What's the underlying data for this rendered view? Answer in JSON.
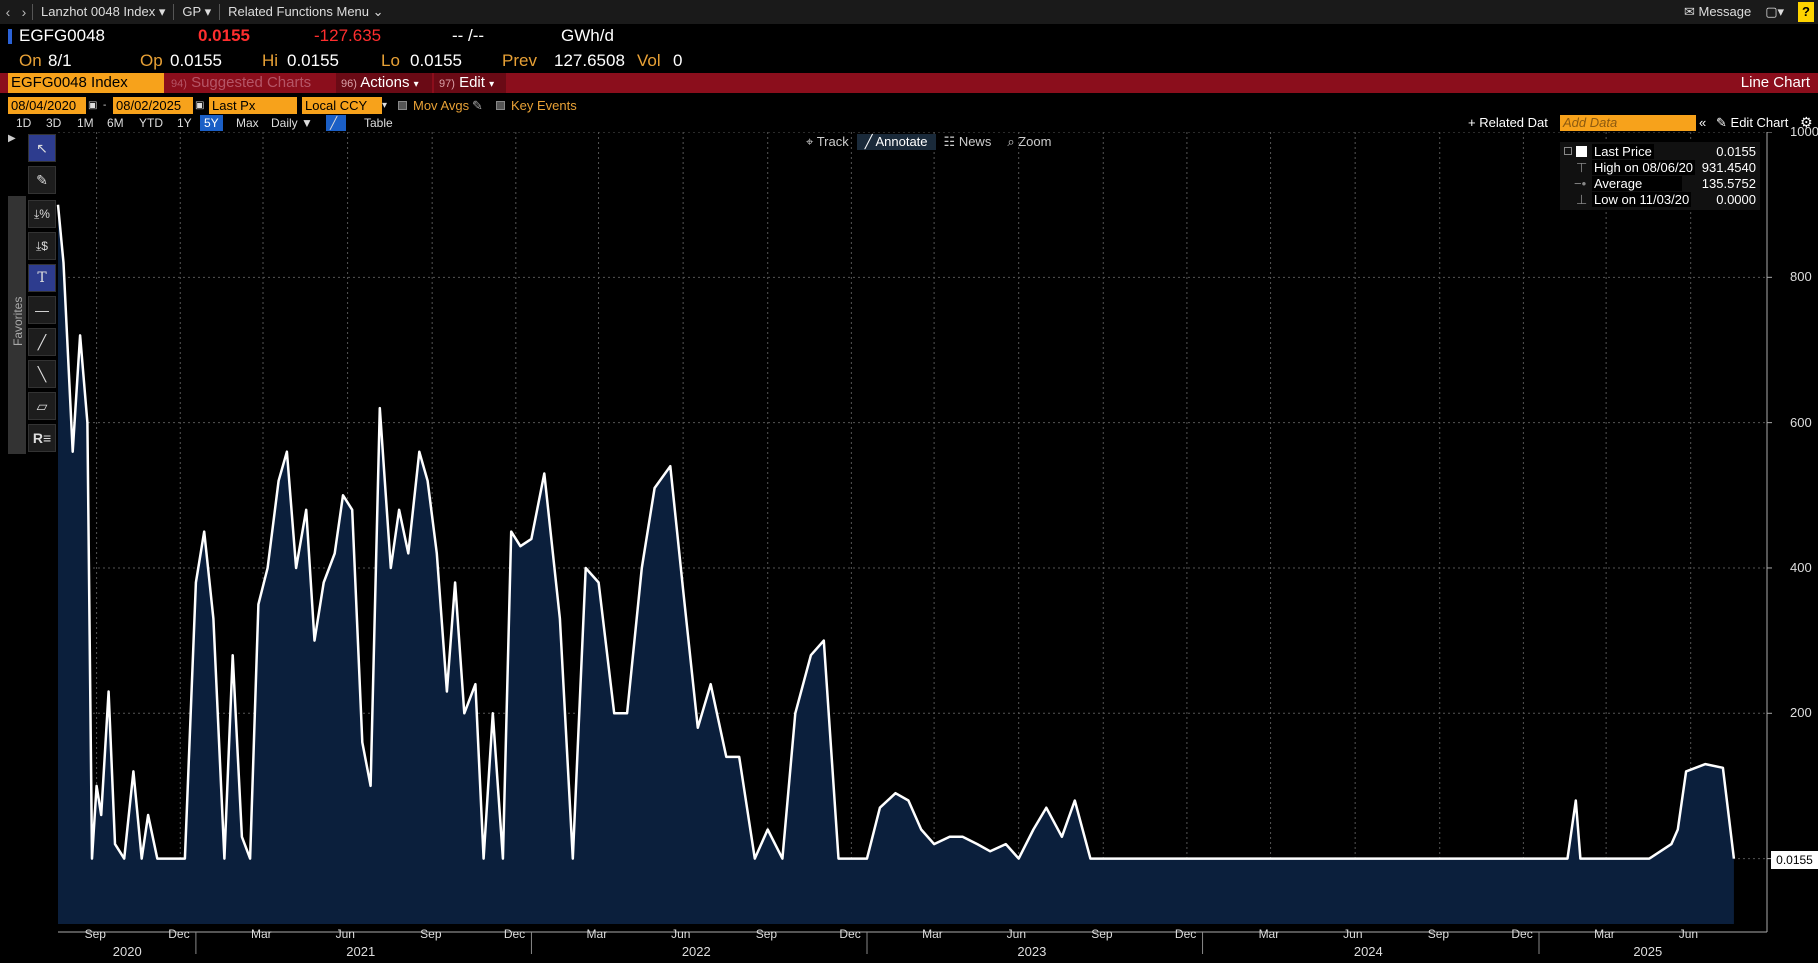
{
  "topbar": {
    "menu1": "Lanzhot 0048 Index",
    "menu2": "GP",
    "menu3": "Related Functions Menu",
    "message": "Message",
    "help": "?"
  },
  "quote": {
    "ticker": "EGFG0048",
    "last": "0.0155",
    "change": "-127.635",
    "time": "-- /--",
    "unit": "GWh/d",
    "on_label": "On",
    "on_date": "8/1",
    "op_label": "Op",
    "op": "0.0155",
    "hi_label": "Hi",
    "hi": "0.0155",
    "lo_label": "Lo",
    "lo": "0.0155",
    "prev_label": "Prev",
    "prev": "127.6508",
    "vol_label": "Vol",
    "vol": "0"
  },
  "redbar": {
    "ticker_field": "EGFG0048 Index",
    "suggested_num": "94)",
    "suggested": "Suggested Charts",
    "actions_num": "96)",
    "actions": "Actions",
    "edit_num": "97)",
    "edit": "Edit",
    "chart_type": "Line Chart"
  },
  "daterow": {
    "start": "08/04/2020",
    "end": "08/02/2025",
    "field": "Last Px",
    "ccy": "Local CCY",
    "mov_avgs": "Mov Avgs",
    "key_events": "Key Events"
  },
  "periods": [
    "1D",
    "3D",
    "1M",
    "6M",
    "YTD",
    "1Y",
    "5Y",
    "Max",
    "Daily",
    "Table"
  ],
  "active_period": "5Y",
  "related_data": "Related Dat",
  "add_data": "Add Data",
  "edit_chart": "Edit Chart",
  "chart_toolbar": [
    "Track",
    "Annotate",
    "News",
    "Zoom"
  ],
  "favorites": "Favorites",
  "legend": {
    "rows": [
      {
        "label": "Last Price",
        "value": "0.0155"
      },
      {
        "label": "High on 08/06/20",
        "value": "931.4540"
      },
      {
        "label": "Average",
        "value": "135.5752"
      },
      {
        "label": "Low on 11/03/20",
        "value": "0.0000"
      }
    ]
  },
  "last_tag": "0.0155",
  "colors": {
    "line": "#ffffff",
    "fill": "#0b1f3c",
    "accent": "#f7a21b",
    "bar": "#8b0e1c"
  },
  "chart_data": {
    "type": "area",
    "title": "",
    "ylim": [
      -90,
      1000
    ],
    "yticks": [
      "200",
      "400",
      "600",
      "800",
      "1000"
    ],
    "xticks": [
      "Sep",
      "Dec",
      "Mar",
      "Jun",
      "Sep",
      "Dec",
      "Mar",
      "Jun",
      "Sep",
      "Dec",
      "Mar",
      "Jun",
      "Sep",
      "Dec",
      "Mar",
      "Jun",
      "Sep",
      "Dec",
      "Mar",
      "Jun"
    ],
    "years": [
      "2020",
      "2021",
      "2022",
      "2023",
      "2024",
      "2025"
    ],
    "series": [
      {
        "x": [
          "2020-08-04",
          "2020-08-10",
          "2020-08-20",
          "2020-08-28",
          "2020-09-05",
          "2020-09-10",
          "2020-09-15",
          "2020-09-20",
          "2020-09-28",
          "2020-10-05",
          "2020-10-15",
          "2020-10-25",
          "2020-11-03",
          "2020-11-10",
          "2020-11-20",
          "2020-12-01",
          "2020-12-10",
          "2020-12-20",
          "2021-01-01",
          "2021-01-10",
          "2021-01-20",
          "2021-02-01",
          "2021-02-10",
          "2021-02-20",
          "2021-03-01",
          "2021-03-10",
          "2021-03-20",
          "2021-04-01",
          "2021-04-10",
          "2021-04-20",
          "2021-05-01",
          "2021-05-10",
          "2021-05-20",
          "2021-06-01",
          "2021-06-10",
          "2021-06-20",
          "2021-07-01",
          "2021-07-10",
          "2021-07-20",
          "2021-08-01",
          "2021-08-10",
          "2021-08-20",
          "2021-09-01",
          "2021-09-10",
          "2021-09-20",
          "2021-10-01",
          "2021-10-10",
          "2021-10-20",
          "2021-11-01",
          "2021-11-10",
          "2021-11-20",
          "2021-12-01",
          "2021-12-10",
          "2021-12-20",
          "2022-01-01",
          "2022-01-15",
          "2022-02-01",
          "2022-02-15",
          "2022-03-01",
          "2022-03-15",
          "2022-04-01",
          "2022-04-15",
          "2022-05-01",
          "2022-05-15",
          "2022-06-01",
          "2022-06-15",
          "2022-07-01",
          "2022-07-15",
          "2022-08-01",
          "2022-08-15",
          "2022-09-01",
          "2022-09-15",
          "2022-10-01",
          "2022-10-15",
          "2022-11-01",
          "2022-11-15",
          "2022-12-01",
          "2022-12-15",
          "2023-01-01",
          "2023-01-15",
          "2023-02-01",
          "2023-02-15",
          "2023-03-01",
          "2023-03-15",
          "2023-04-01",
          "2023-04-15",
          "2023-05-01",
          "2023-05-15",
          "2023-06-01",
          "2023-06-15",
          "2023-07-01",
          "2023-07-15",
          "2023-08-01",
          "2023-08-15",
          "2023-09-01",
          "2023-09-15",
          "2023-10-01",
          "2024-01-01",
          "2024-06-01",
          "2024-12-01",
          "2025-02-01",
          "2025-02-10",
          "2025-02-15",
          "2025-03-01",
          "2025-05-01",
          "2025-05-25",
          "2025-06-01",
          "2025-06-10",
          "2025-07-01",
          "2025-07-20",
          "2025-08-01"
        ],
        "values": [
          900,
          820,
          560,
          720,
          600,
          0,
          100,
          60,
          230,
          20,
          0,
          120,
          0,
          60,
          0,
          0,
          0,
          0,
          380,
          450,
          330,
          0,
          280,
          30,
          0,
          350,
          400,
          520,
          560,
          400,
          480,
          300,
          380,
          420,
          500,
          480,
          160,
          100,
          620,
          400,
          480,
          420,
          560,
          520,
          420,
          230,
          380,
          200,
          240,
          0,
          200,
          0,
          450,
          430,
          440,
          530,
          330,
          0,
          400,
          380,
          200,
          200,
          400,
          510,
          540,
          370,
          180,
          240,
          140,
          140,
          0,
          40,
          0,
          200,
          280,
          300,
          0,
          0,
          0,
          70,
          90,
          80,
          40,
          20,
          30,
          30,
          20,
          10,
          20,
          0,
          40,
          70,
          30,
          80,
          0,
          0,
          0,
          0,
          0,
          0,
          0,
          80,
          0,
          0,
          0,
          20,
          40,
          120,
          130,
          125,
          0
        ]
      }
    ]
  }
}
